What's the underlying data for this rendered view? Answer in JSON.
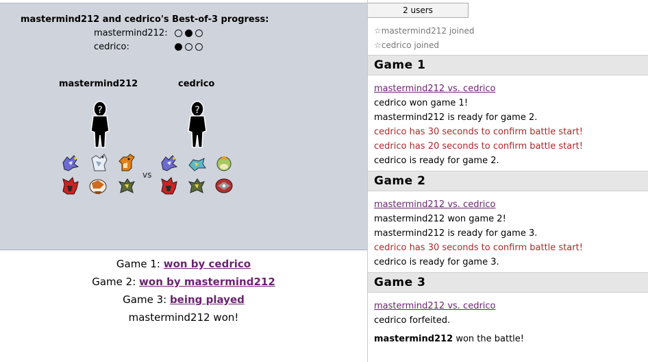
{
  "progress": {
    "title": "mastermind212 and cedrico's Best-of-3 progress:",
    "rows": [
      {
        "name": "mastermind212:",
        "dots": [
          false,
          true,
          false
        ]
      },
      {
        "name": "cedrico:",
        "dots": [
          true,
          false,
          false
        ]
      }
    ]
  },
  "players": {
    "p1": "mastermind212",
    "p2": "cedrico",
    "vs": "vs"
  },
  "results": {
    "g1_prefix": "Game 1: ",
    "g1_link": "won by cedrico",
    "g2_prefix": "Game 2: ",
    "g2_link": "won by mastermind212",
    "g3_prefix": "Game 3: ",
    "g3_link": "being played",
    "final": "mastermind212 won!"
  },
  "chat": {
    "users_tab": "2 users",
    "joins": [
      "☆mastermind212 joined",
      "☆cedrico joined"
    ],
    "games": [
      {
        "header": "Game 1",
        "lines": [
          {
            "text": "mastermind212 vs. cedrico",
            "style": "link"
          },
          {
            "text": "cedrico won game 1!",
            "style": "normal"
          },
          {
            "text": "mastermind212 is ready for game 2.",
            "style": "normal"
          },
          {
            "text": "cedrico has 30 seconds to confirm battle start!",
            "style": "red"
          },
          {
            "text": "cedrico has 20 seconds to confirm battle start!",
            "style": "red"
          },
          {
            "text": "cedrico is ready for game 2.",
            "style": "normal"
          }
        ]
      },
      {
        "header": "Game 2",
        "lines": [
          {
            "text": "mastermind212 vs. cedrico",
            "style": "link"
          },
          {
            "text": "mastermind212 won game 2!",
            "style": "normal"
          },
          {
            "text": "mastermind212 is ready for game 3.",
            "style": "normal"
          },
          {
            "text": "cedrico has 30 seconds to confirm battle start!",
            "style": "red"
          },
          {
            "text": "cedrico is ready for game 3.",
            "style": "normal"
          }
        ]
      },
      {
        "header": "Game 3",
        "lines": [
          {
            "text": "mastermind212 vs. cedrico",
            "style": "link"
          },
          {
            "text": "cedrico forfeited.",
            "style": "normal"
          }
        ]
      }
    ],
    "winner_name": "mastermind212",
    "winner_text": " won the battle!"
  }
}
